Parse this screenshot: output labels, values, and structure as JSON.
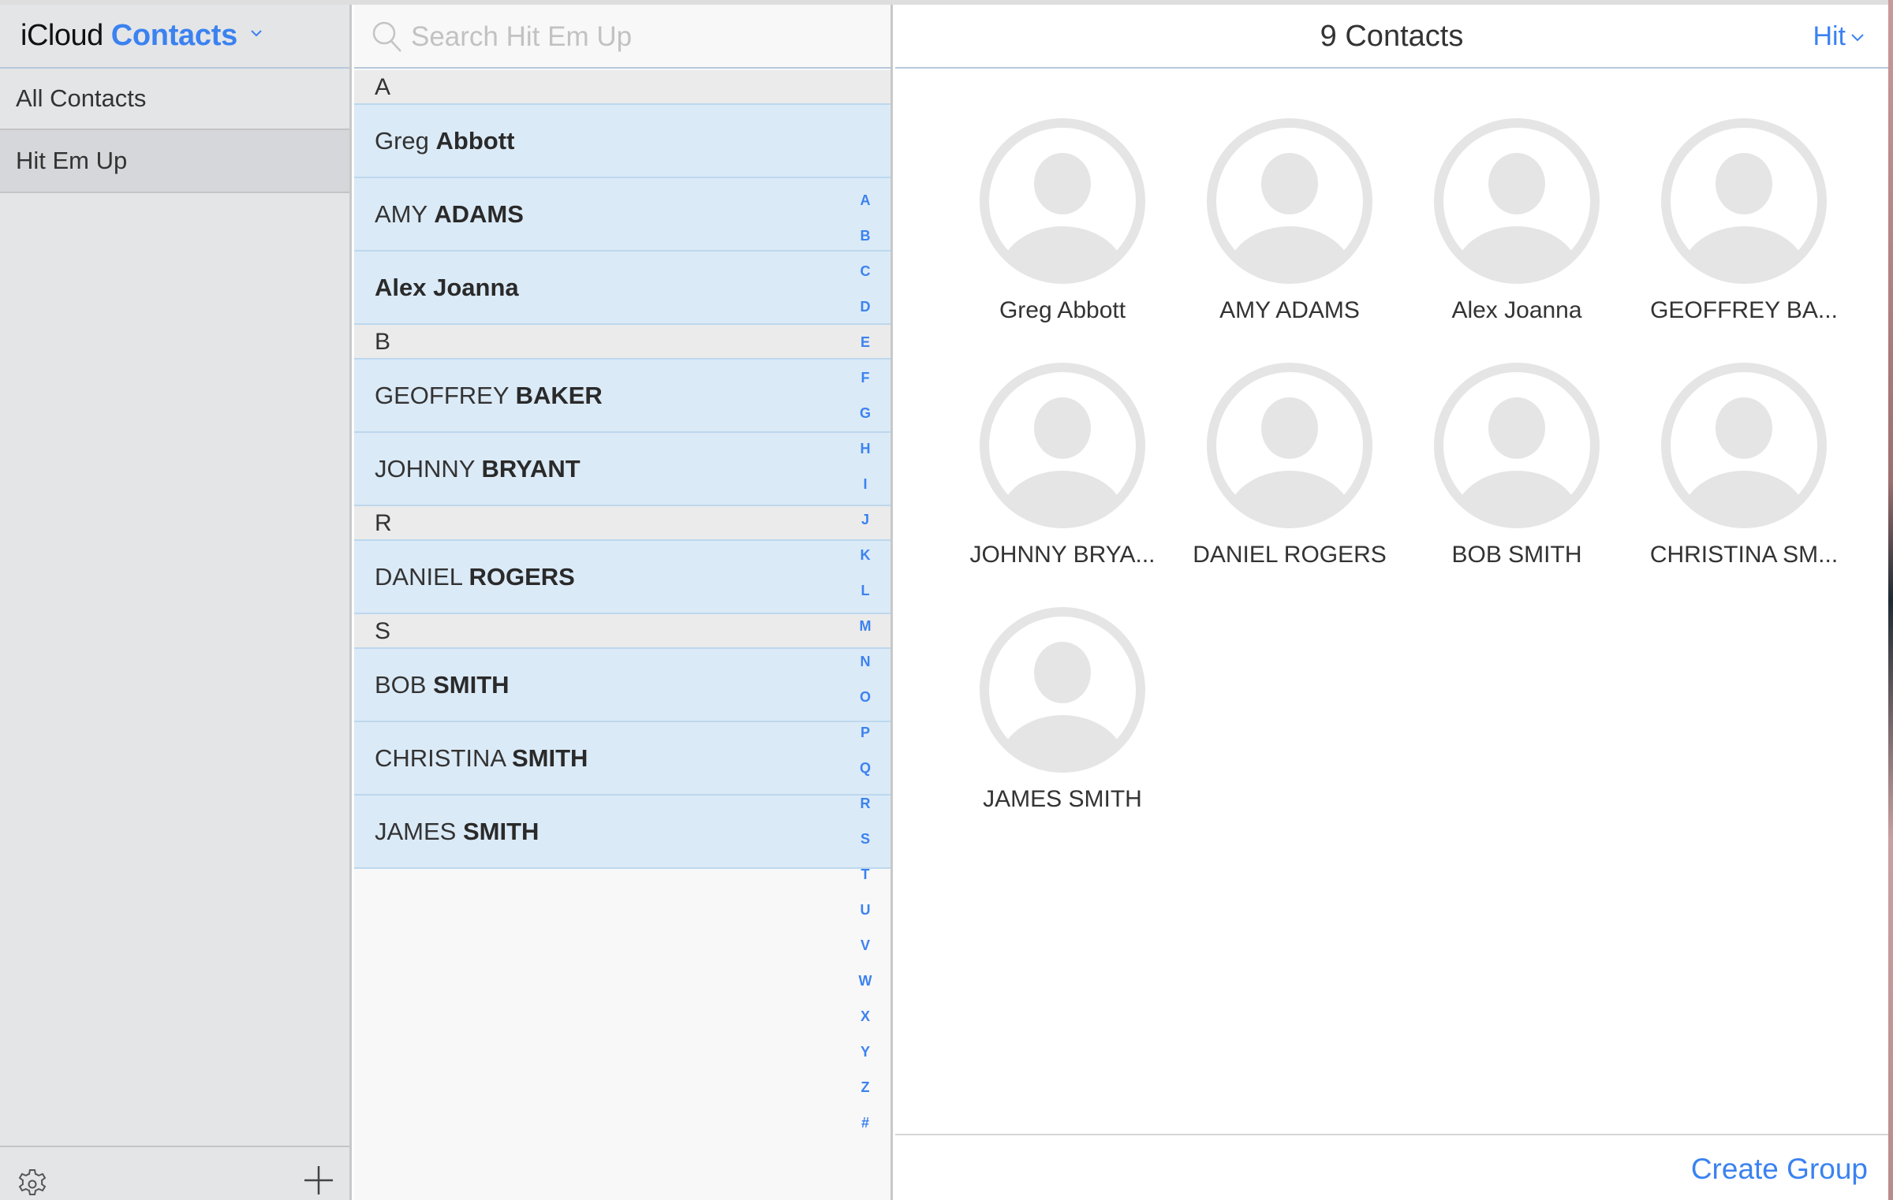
{
  "sidebar": {
    "title_prefix": "iCloud",
    "title_app": "Contacts",
    "groups": [
      {
        "label": "All Contacts",
        "selected": false
      },
      {
        "label": "Hit Em Up",
        "selected": true
      }
    ],
    "settings_icon": "gear-icon",
    "add_icon": "plus-icon"
  },
  "list": {
    "search": {
      "placeholder": "Search Hit Em Up",
      "value": ""
    },
    "sections": [
      {
        "letter": "A",
        "contacts": [
          {
            "first": "Greg",
            "last": "Abbott"
          },
          {
            "first": "AMY",
            "last": "ADAMS"
          },
          {
            "first": "Alex Joanna",
            "last": ""
          }
        ]
      },
      {
        "letter": "B",
        "contacts": [
          {
            "first": "GEOFFREY",
            "last": "BAKER"
          },
          {
            "first": "JOHNNY",
            "last": "BRYANT"
          }
        ]
      },
      {
        "letter": "R",
        "contacts": [
          {
            "first": "DANIEL",
            "last": "ROGERS"
          }
        ]
      },
      {
        "letter": "S",
        "contacts": [
          {
            "first": "BOB",
            "last": "SMITH"
          },
          {
            "first": "CHRISTINA",
            "last": "SMITH"
          },
          {
            "first": "JAMES",
            "last": "SMITH"
          }
        ]
      }
    ],
    "index_letters": [
      "A",
      "B",
      "C",
      "D",
      "E",
      "F",
      "G",
      "H",
      "I",
      "J",
      "K",
      "L",
      "M",
      "N",
      "O",
      "P",
      "Q",
      "R",
      "S",
      "T",
      "U",
      "V",
      "W",
      "X",
      "Y",
      "Z",
      "#"
    ]
  },
  "detail": {
    "title": "9 Contacts",
    "filter_label": "Hit",
    "cards": [
      "Greg Abbott",
      "AMY ADAMS",
      "Alex Joanna",
      "GEOFFREY BA...",
      "JOHNNY BRYA...",
      "DANIEL ROGERS",
      "BOB SMITH",
      "CHRISTINA SM...",
      "JAMES SMITH"
    ],
    "footer_button": "Create Group"
  },
  "colors": {
    "accent": "#3b82f0",
    "row_selected": "#dbeaf7",
    "sidebar_bg": "#e4e5e7",
    "avatar_gray": "#e5e5e5"
  }
}
